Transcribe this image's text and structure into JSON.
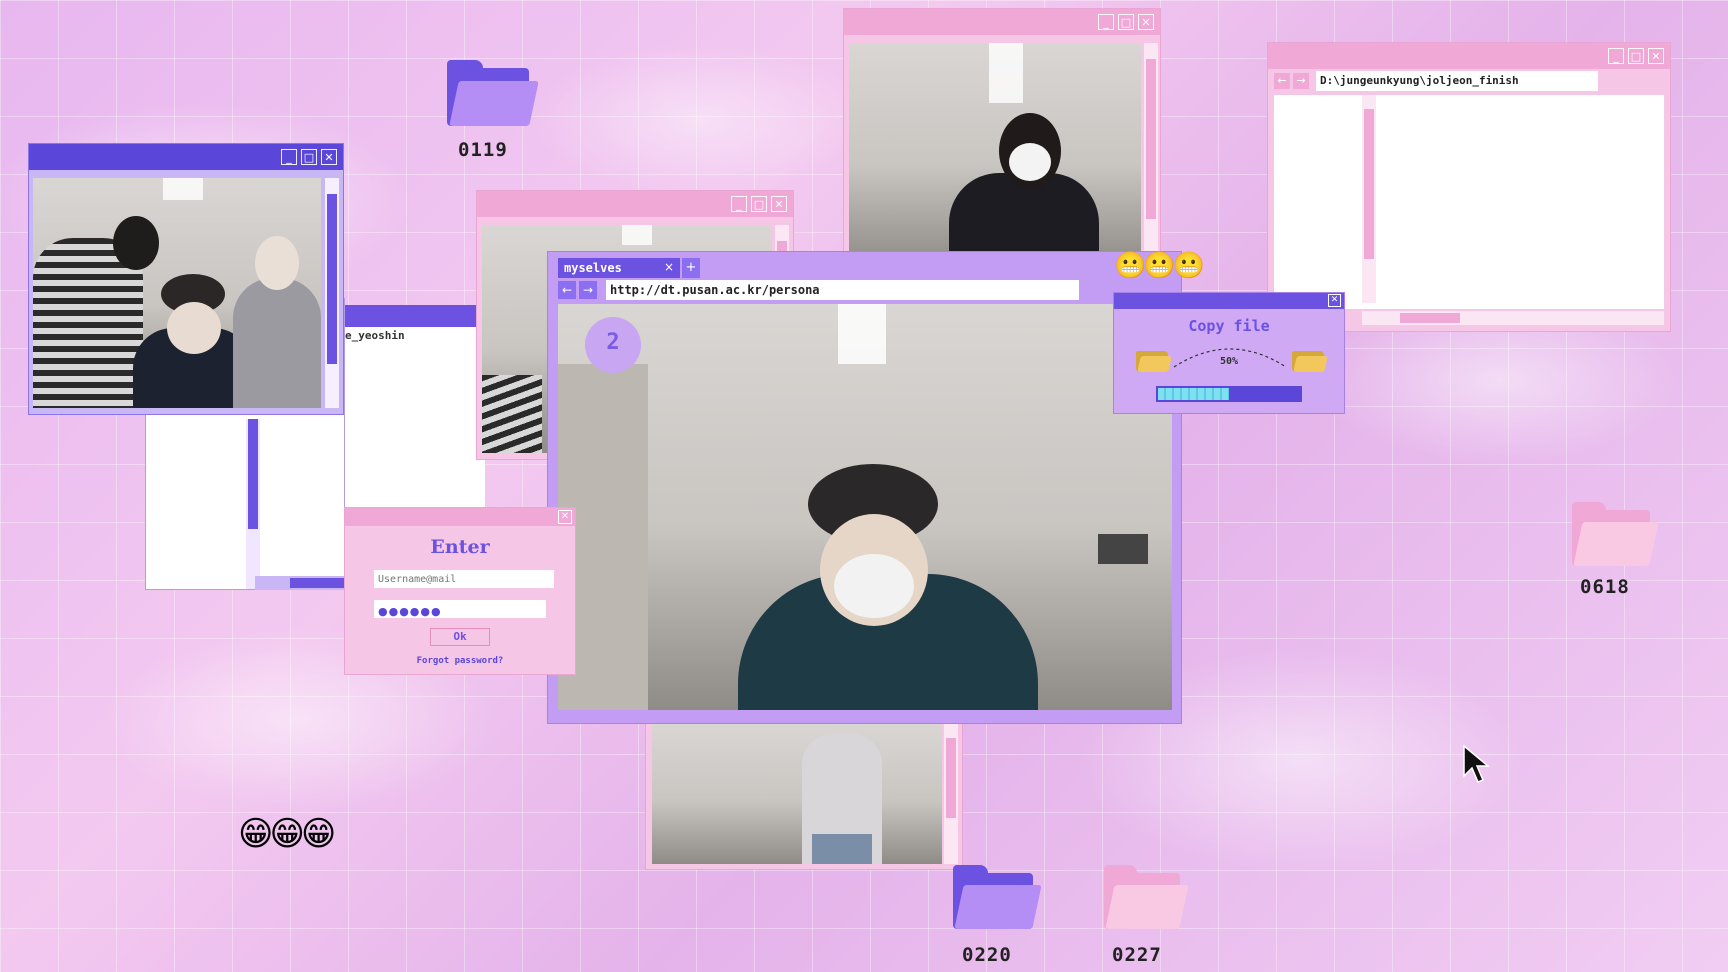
{
  "desktop": {
    "folders": [
      {
        "label": "0119"
      },
      {
        "label": "0618"
      },
      {
        "label": "0220"
      },
      {
        "label": "0227"
      }
    ],
    "emoji_bottom": "😁😁😁",
    "emoji_top": "😬😬😬"
  },
  "explorer_left": {
    "path": "e_yeoshin"
  },
  "explorer_right": {
    "path": "D:\\jungeunkyung\\joljeon_finish"
  },
  "browser": {
    "tab_label": "myselves",
    "tab_close": "×",
    "new_tab": "+",
    "url": "http://dt.pusan.ac.kr/persona",
    "badge": "2"
  },
  "copy_dialog": {
    "title": "Copy file",
    "percent": "50%",
    "progress": 0.5
  },
  "login": {
    "title": "Enter",
    "username_placeholder": "Username@mail",
    "password_mask": "●●●●●●",
    "ok_label": "Ok",
    "forgot_label": "Forgot password?"
  },
  "colors": {
    "pink": "#f0a8d6",
    "purple": "#9a6cf0",
    "indigo": "#5a46d9",
    "panel": "#f3c0e2"
  }
}
